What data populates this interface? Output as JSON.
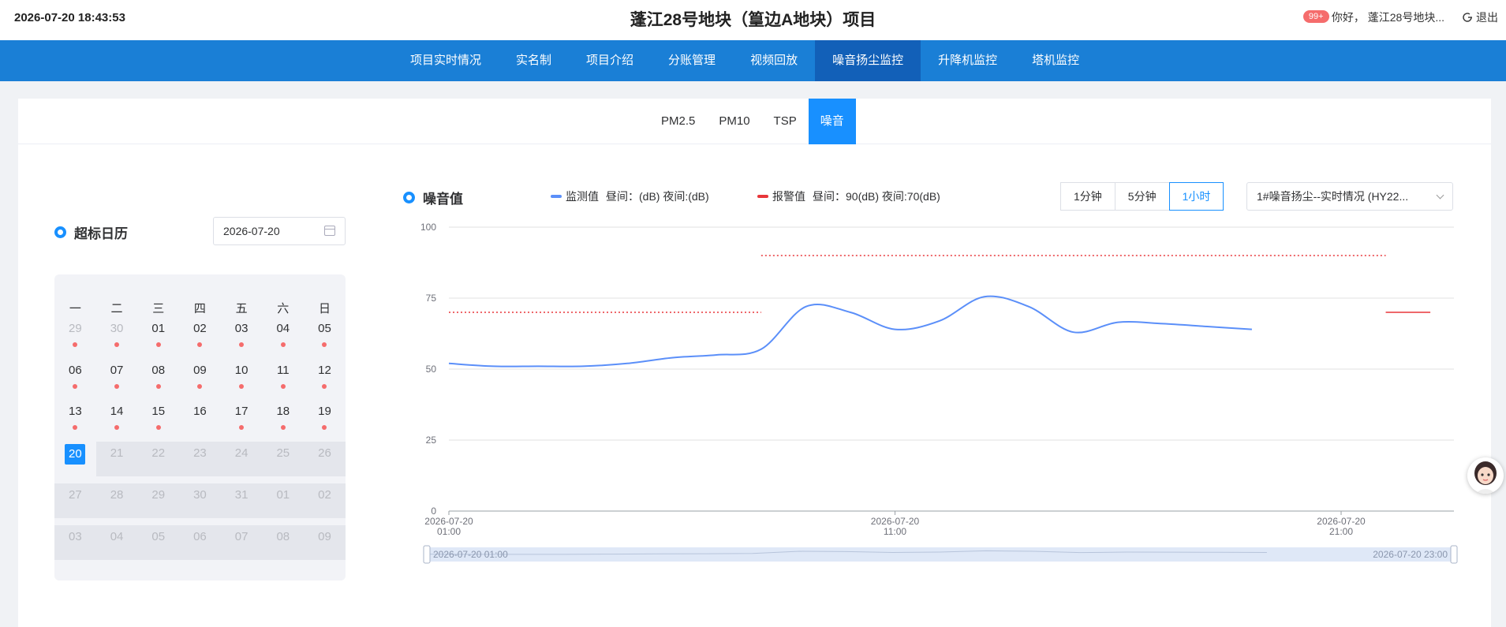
{
  "header": {
    "datetime": "2026-07-20 18:43:53",
    "title": "蓬江28号地块（篁边A地块）项目",
    "badge": "99+",
    "greeting": "你好， 蓬江28号地块...",
    "logout": "退出"
  },
  "nav": {
    "items": [
      "项目实时情况",
      "实名制",
      "项目介绍",
      "分账管理",
      "视频回放",
      "噪音扬尘监控",
      "升降机监控",
      "塔机监控"
    ],
    "active": "噪音扬尘监控"
  },
  "subtabs": {
    "items": [
      "PM2.5",
      "PM10",
      "TSP",
      "噪音"
    ],
    "active": "噪音"
  },
  "calendar": {
    "title": "超标日历",
    "date_value": "2026-07-20",
    "weekdays": [
      "一",
      "二",
      "三",
      "四",
      "五",
      "六",
      "日"
    ],
    "weeks": [
      [
        {
          "d": "29",
          "m": true,
          "dot": true
        },
        {
          "d": "30",
          "m": true,
          "dot": true
        },
        {
          "d": "01",
          "dot": true
        },
        {
          "d": "02",
          "dot": true
        },
        {
          "d": "03",
          "dot": true
        },
        {
          "d": "04",
          "dot": true
        },
        {
          "d": "05",
          "dot": true
        }
      ],
      [
        {
          "d": "06",
          "dot": true
        },
        {
          "d": "07",
          "dot": true
        },
        {
          "d": "08",
          "dot": true
        },
        {
          "d": "09",
          "dot": true
        },
        {
          "d": "10",
          "dot": true
        },
        {
          "d": "11",
          "dot": true
        },
        {
          "d": "12",
          "dot": true
        }
      ],
      [
        {
          "d": "13",
          "dot": true
        },
        {
          "d": "14",
          "dot": true
        },
        {
          "d": "15",
          "dot": true
        },
        {
          "d": "16"
        },
        {
          "d": "17",
          "dot": true
        },
        {
          "d": "18",
          "dot": true
        },
        {
          "d": "19",
          "dot": true
        }
      ],
      [
        {
          "d": "20",
          "today": true
        },
        {
          "d": "21",
          "m": true,
          "g": true
        },
        {
          "d": "22",
          "m": true,
          "g": true
        },
        {
          "d": "23",
          "m": true,
          "g": true
        },
        {
          "d": "24",
          "m": true,
          "g": true
        },
        {
          "d": "25",
          "m": true,
          "g": true
        },
        {
          "d": "26",
          "m": true,
          "g": true
        }
      ],
      [
        {
          "d": "27",
          "m": true,
          "g": true
        },
        {
          "d": "28",
          "m": true,
          "g": true
        },
        {
          "d": "29",
          "m": true,
          "g": true
        },
        {
          "d": "30",
          "m": true,
          "g": true
        },
        {
          "d": "31",
          "m": true,
          "g": true
        },
        {
          "d": "01",
          "m": true,
          "g": true
        },
        {
          "d": "02",
          "m": true,
          "g": true
        }
      ],
      [
        {
          "d": "03",
          "m": true,
          "g": true
        },
        {
          "d": "04",
          "m": true,
          "g": true
        },
        {
          "d": "05",
          "m": true,
          "g": true
        },
        {
          "d": "06",
          "m": true,
          "g": true
        },
        {
          "d": "07",
          "m": true,
          "g": true
        },
        {
          "d": "08",
          "m": true,
          "g": true
        },
        {
          "d": "09",
          "m": true,
          "g": true
        }
      ]
    ]
  },
  "chart_panel": {
    "title": "噪音值",
    "legend_monitor": "监测值",
    "legend_monitor_detail": "昼间：(dB)  夜间:(dB)",
    "legend_alarm": "报警值",
    "legend_alarm_detail": "昼间：90(dB)  夜间:70(dB)",
    "interval_buttons": [
      "1分钟",
      "5分钟",
      "1小时"
    ],
    "interval_active": "1小时",
    "device_select": "1#噪音扬尘--实时情况 (HY22...",
    "zoom_start": "2026-07-20 01:00",
    "zoom_end": "2026-07-20 23:00"
  },
  "colors": {
    "primary": "#1890ff",
    "nav": "#1a7fd6",
    "nav_active": "#1260b8",
    "monitor_line": "#5b8ff9",
    "alarm_line": "#e8363a",
    "dot": "#f56c6c"
  },
  "chart_data": {
    "type": "line",
    "ylim": [
      0,
      100
    ],
    "yticks": [
      "0",
      "25",
      "50",
      "75",
      "100"
    ],
    "xtick_labels": [
      [
        "2026-07-20",
        "01:00"
      ],
      [
        "2026-07-20",
        "11:00"
      ],
      [
        "2026-07-20",
        "21:00"
      ]
    ],
    "x_hours": [
      1,
      2,
      3,
      4,
      5,
      6,
      7,
      8,
      9,
      10,
      11,
      12,
      13,
      14,
      15,
      16,
      17,
      18,
      19
    ],
    "series": [
      {
        "name": "监测值",
        "values": [
          52,
          51,
          51,
          51,
          52,
          54,
          55,
          57,
          72,
          70,
          64,
          67,
          75.5,
          72,
          63,
          66.5,
          66,
          65,
          64
        ]
      }
    ],
    "alarm": [
      {
        "from_hour": 1,
        "to_hour": 8,
        "value": 70,
        "style": "dotted"
      },
      {
        "from_hour": 8,
        "to_hour": 22,
        "value": 90,
        "style": "dotted"
      },
      {
        "from_hour": 22,
        "to_hour": 23,
        "value": 70,
        "style": "solid"
      }
    ]
  }
}
